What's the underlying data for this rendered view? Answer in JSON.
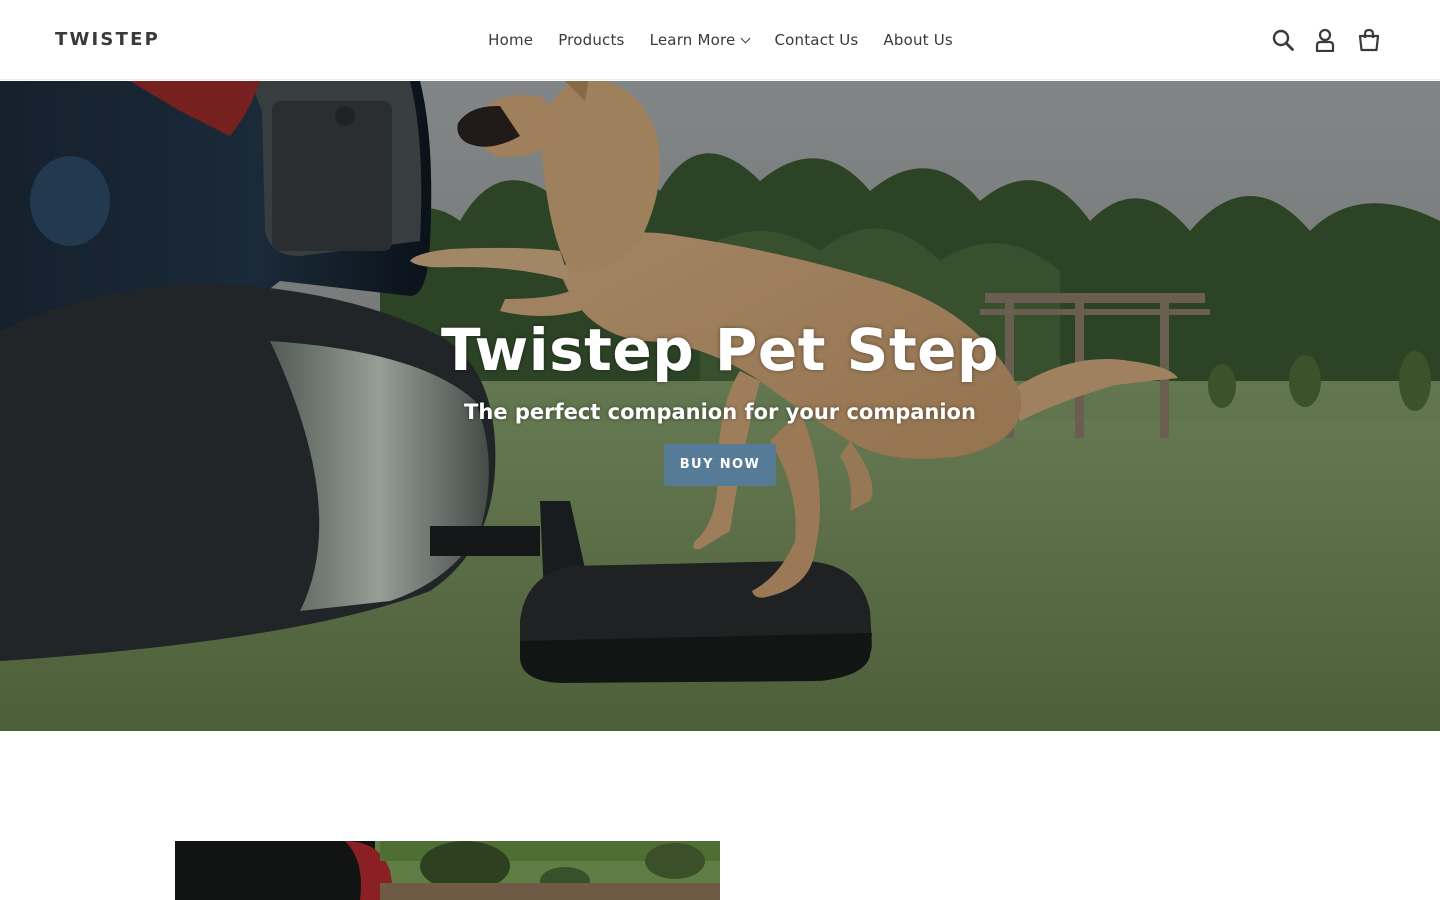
{
  "header": {
    "logo": "TWISTEP",
    "nav": [
      {
        "label": "Home"
      },
      {
        "label": "Products"
      },
      {
        "label": "Learn More",
        "has_dropdown": true
      },
      {
        "label": "Contact Us"
      },
      {
        "label": "About Us"
      }
    ],
    "icons": [
      "search-icon",
      "account-icon",
      "cart-icon"
    ]
  },
  "hero": {
    "title": "Twistep Pet Step",
    "subtitle": "The perfect companion for your companion",
    "button_label": "Buy Now"
  },
  "colors": {
    "button": "#557b97",
    "text": "#3a3a3a",
    "header_bg": "#ffffff"
  }
}
